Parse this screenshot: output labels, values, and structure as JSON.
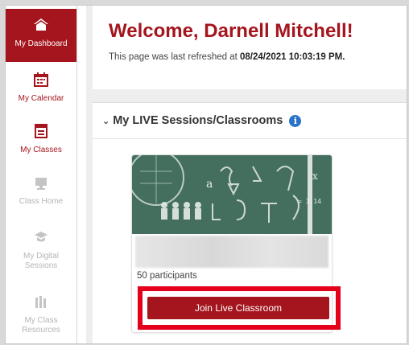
{
  "sidebar": {
    "items": [
      {
        "label": "My Dashboard",
        "icon": "home-icon",
        "state": "active"
      },
      {
        "label": "My Calendar",
        "icon": "calendar-icon",
        "state": "enabled"
      },
      {
        "label": "My Classes",
        "icon": "classes-icon",
        "state": "enabled"
      },
      {
        "label": "Class Home",
        "icon": "class-home-icon",
        "state": "disabled"
      },
      {
        "label": "My Digital Sessions",
        "icon": "digital-sessions-icon",
        "state": "disabled"
      },
      {
        "label": "My Class Resources",
        "icon": "class-resources-icon",
        "state": "disabled"
      }
    ]
  },
  "welcome": {
    "title": "Welcome, Darnell Mitchell!",
    "refresh_prefix": "This page was last refreshed at ",
    "refresh_time": "08/24/2021 10:03:19 PM."
  },
  "sessions": {
    "header": "My LIVE Sessions/Classrooms",
    "info_icon": "info-icon",
    "card": {
      "participants": "50 participants",
      "join_label": "Join Live Classroom"
    }
  },
  "colors": {
    "brand_red": "#a4151e",
    "highlight_red": "#e4001b",
    "info_blue": "#2a73c9"
  }
}
